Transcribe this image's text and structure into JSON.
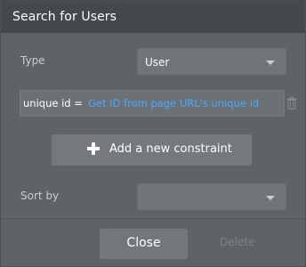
{
  "dialog": {
    "title": "Search for Users"
  },
  "type_row": {
    "label": "Type",
    "selected": "User"
  },
  "constraint": {
    "field": "unique id =",
    "expression": "Get ID from page URL's unique id"
  },
  "add_constraint": {
    "label": "Add a new constraint"
  },
  "sort_row": {
    "label": "Sort by",
    "selected": ""
  },
  "footer": {
    "close_label": "Close",
    "delete_label": "Delete"
  },
  "icons": {
    "type_caret": "chevron-down-icon",
    "sort_caret": "chevron-down-icon",
    "add": "plus-icon",
    "remove_constraint": "trash-icon"
  },
  "colors": {
    "header_bg": "#44494d",
    "panel_bg": "#5d6367",
    "link_blue": "#4aa8ff"
  }
}
